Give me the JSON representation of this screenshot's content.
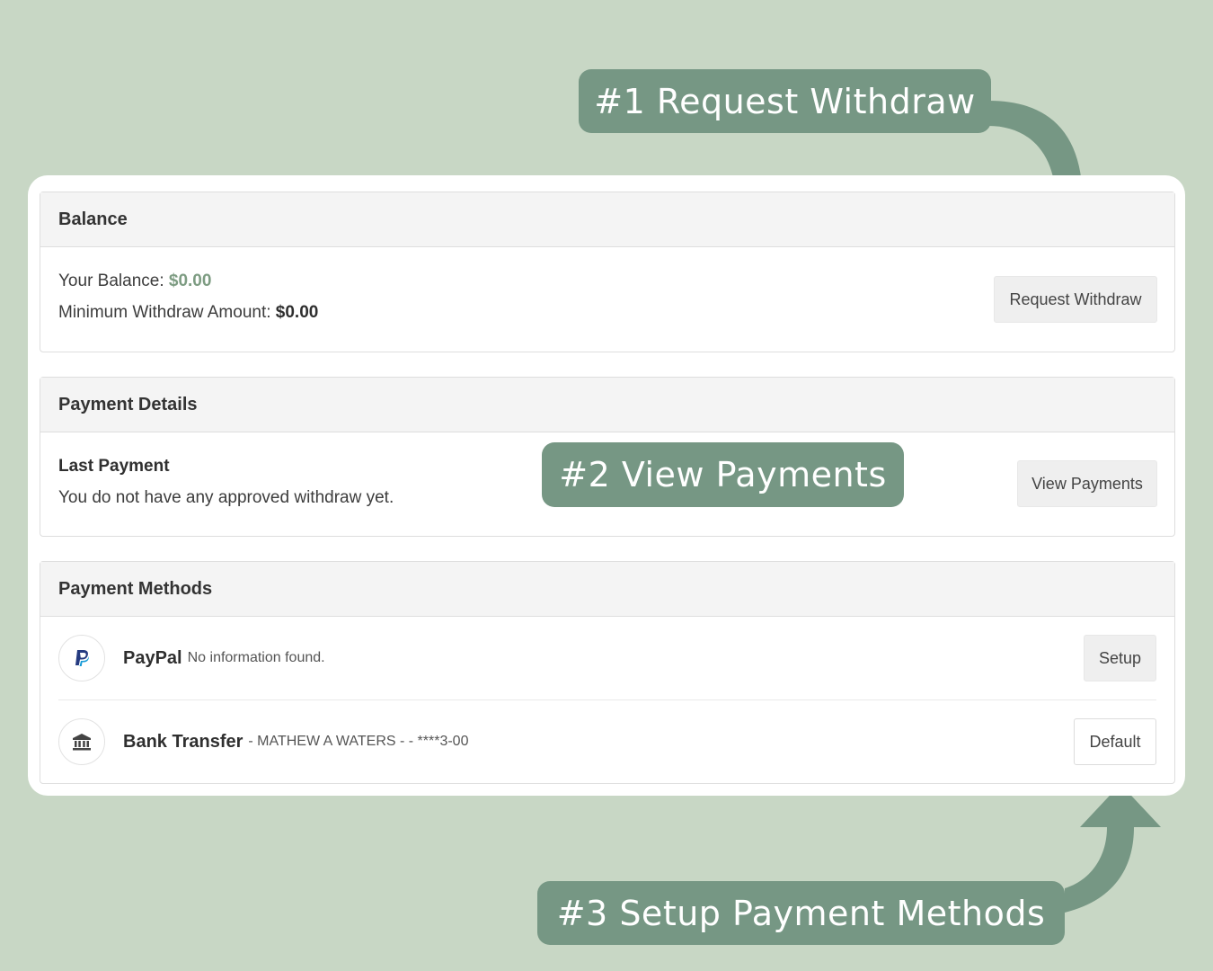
{
  "balance": {
    "title": "Balance",
    "your_balance_label": "Your Balance:",
    "your_balance_value": "$0.00",
    "min_withdraw_label": "Minimum Withdraw Amount:",
    "min_withdraw_value": "$0.00",
    "request_button": "Request Withdraw"
  },
  "payment_details": {
    "title": "Payment Details",
    "last_payment_label": "Last Payment",
    "last_payment_text": "You do not have any approved withdraw yet.",
    "view_button": "View Payments"
  },
  "payment_methods": {
    "title": "Payment Methods",
    "items": [
      {
        "name": "PayPal",
        "info": "No information found.",
        "icon": "paypal-icon",
        "button": "Setup"
      },
      {
        "name": "Bank Transfer",
        "info": "- MATHEW A WATERS - - ****3-00",
        "icon": "bank-icon",
        "button": "Default"
      }
    ]
  },
  "callouts": {
    "one": "#1 Request Withdraw",
    "two": "#2 View Payments",
    "three": "#3 Setup Payment Methods"
  },
  "colors": {
    "background": "#c8d7c5",
    "accent": "#769784",
    "balance_green": "#7d9c82"
  }
}
